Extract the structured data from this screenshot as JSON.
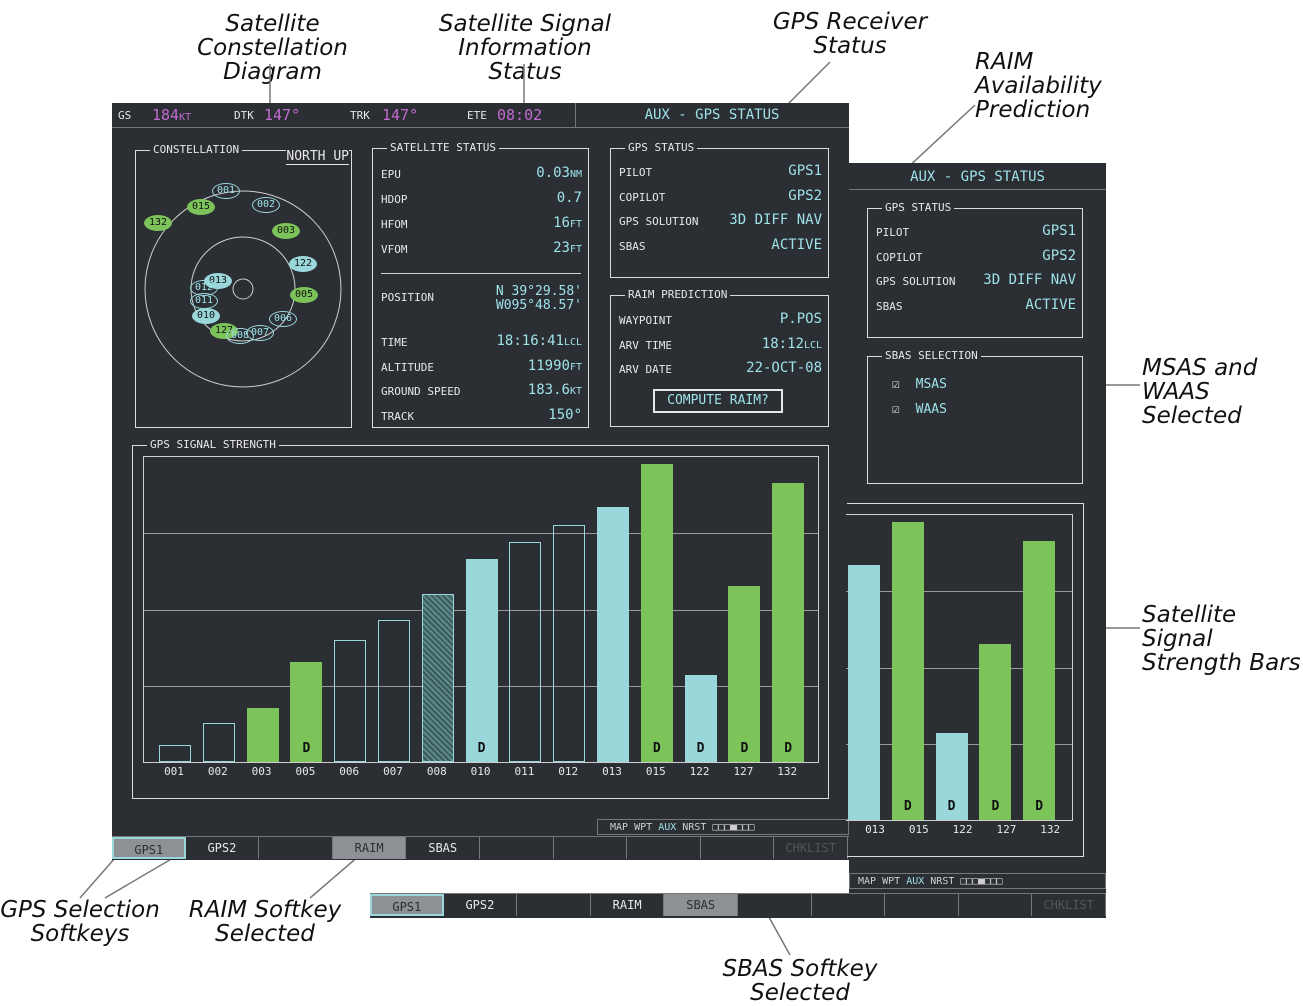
{
  "callouts": {
    "constellation": "Satellite Constellation\nDiagram",
    "signal_info": "Satellite Signal\nInformation Status",
    "receiver_status": "GPS Receiver\nStatus",
    "raim_prediction": "RAIM\nAvailability\nPrediction",
    "msas_waas": "MSAS and\nWAAS\nSelected",
    "strength_bars": "Satellite Signal\nStrength Bars",
    "gps_softkeys": "GPS Selection\nSoftkeys",
    "raim_softkey": "RAIM Softkey\nSelected",
    "sbas_softkey": "SBAS Softkey\nSelected"
  },
  "topbar": {
    "gs_label": "GS",
    "gs_value": "184",
    "gs_unit": "KT",
    "dtk_label": "DTK",
    "dtk_value": "147°",
    "trk_label": "TRK",
    "trk_value": "147°",
    "ete_label": "ETE",
    "ete_value": "08:02",
    "page_title": "AUX - GPS STATUS"
  },
  "constellation": {
    "title": "CONSTELLATION",
    "orientation": "NORTH UP"
  },
  "satellite_status": {
    "title": "SATELLITE STATUS",
    "rows": [
      {
        "label": "EPU",
        "value": "0.03",
        "unit": "NM"
      },
      {
        "label": "HDOP",
        "value": "0.7",
        "unit": ""
      },
      {
        "label": "HFOM",
        "value": "16",
        "unit": "FT"
      },
      {
        "label": "VFOM",
        "value": "23",
        "unit": "FT"
      }
    ],
    "position_label": "POSITION",
    "lat": "N 39°29.58'",
    "lon": "W095°48.57'",
    "rows2": [
      {
        "label": "TIME",
        "value": "18:16:41",
        "unit": "LCL"
      },
      {
        "label": "ALTITUDE",
        "value": "11990",
        "unit": "FT"
      },
      {
        "label": "GROUND SPEED",
        "value": "183.6",
        "unit": "KT"
      },
      {
        "label": "TRACK",
        "value": "150°",
        "unit": ""
      }
    ]
  },
  "gps_status": {
    "title": "GPS STATUS",
    "rows": [
      {
        "label": "PILOT",
        "value": "GPS1"
      },
      {
        "label": "COPILOT",
        "value": "GPS2"
      },
      {
        "label": "GPS SOLUTION",
        "value": "3D DIFF NAV"
      },
      {
        "label": "SBAS",
        "value": "ACTIVE"
      }
    ]
  },
  "raim": {
    "title": "RAIM PREDICTION",
    "rows": [
      {
        "label": "WAYPOINT",
        "value": "P.POS",
        "unit": ""
      },
      {
        "label": "ARV TIME",
        "value": "18:12",
        "unit": "LCL"
      },
      {
        "label": "ARV DATE",
        "value": "22-OCT-08",
        "unit": ""
      }
    ],
    "button": "COMPUTE RAIM?"
  },
  "signal_strength_title": "GPS SIGNAL STRENGTH",
  "sbas_selection": {
    "title": "SBAS SELECTION",
    "items": [
      "MSAS",
      "WAAS"
    ]
  },
  "page_nav": {
    "prefix": "MAP WPT",
    "active": "AUX",
    "suffix": "NRST"
  },
  "softkeys1": [
    "GPS1",
    "GPS2",
    "",
    "RAIM",
    "SBAS",
    "",
    "",
    "",
    "",
    "CHKLIST"
  ],
  "softkeys2": [
    "GPS1",
    "GPS2",
    "",
    "RAIM",
    "SBAS",
    "",
    "",
    "",
    "",
    "CHKLIST"
  ],
  "chart_data": {
    "type": "bar",
    "categories": [
      "001",
      "002",
      "003",
      "005",
      "006",
      "007",
      "008",
      "010",
      "011",
      "012",
      "013",
      "015",
      "122",
      "127",
      "132"
    ],
    "values": [
      8,
      18,
      25,
      46,
      56,
      65,
      77,
      93,
      101,
      109,
      117,
      137,
      40,
      81,
      128
    ],
    "status": [
      "empty",
      "empty",
      "green",
      "green",
      "empty",
      "empty",
      "hatched",
      "cyan",
      "empty",
      "empty",
      "cyan",
      "green",
      "cyan",
      "green",
      "green"
    ],
    "differential": [
      false,
      false,
      false,
      true,
      false,
      false,
      false,
      true,
      false,
      false,
      false,
      true,
      true,
      true,
      true
    ],
    "ylim": [
      0,
      140
    ],
    "colors": {
      "cyan": "#9ad7db",
      "green": "#7cc35a"
    }
  },
  "chart_data_zoom": {
    "categories": [
      "013",
      "015",
      "122",
      "127",
      "132"
    ],
    "values": [
      117,
      137,
      40,
      81,
      128
    ],
    "status": [
      "cyan",
      "green",
      "cyan",
      "green",
      "green"
    ],
    "differential": [
      false,
      true,
      true,
      true,
      true
    ]
  },
  "satellites": [
    "001",
    "002",
    "015",
    "132",
    "003",
    "122",
    "013",
    "012",
    "011",
    "005",
    "010",
    "006",
    "127",
    "008",
    "007"
  ],
  "d_marker": "D"
}
